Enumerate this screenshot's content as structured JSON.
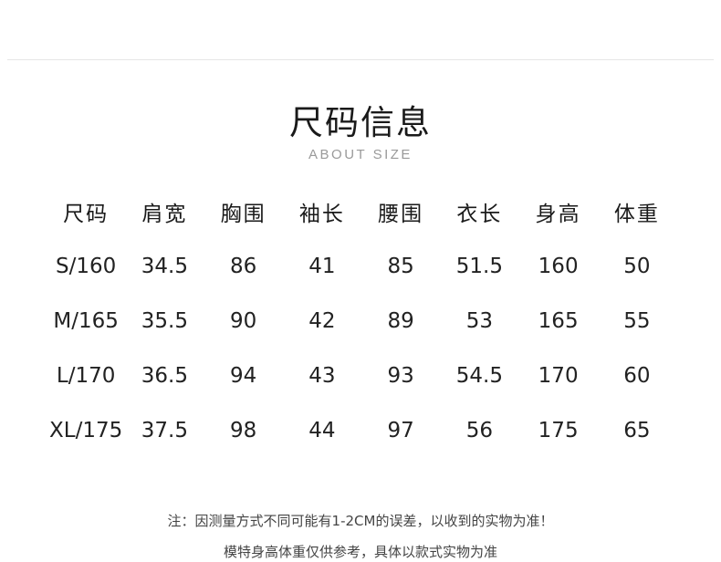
{
  "heading": {
    "title": "尺码信息",
    "subtitle": "ABOUT SIZE"
  },
  "table": {
    "headers": [
      "尺码",
      "肩宽",
      "胸围",
      "袖长",
      "腰围",
      "衣长",
      "身高",
      "体重"
    ],
    "rows": [
      [
        "S/160",
        "34.5",
        "86",
        "41",
        "85",
        "51.5",
        "160",
        "50"
      ],
      [
        "M/165",
        "35.5",
        "90",
        "42",
        "89",
        "53",
        "165",
        "55"
      ],
      [
        "L/170",
        "36.5",
        "94",
        "43",
        "93",
        "54.5",
        "170",
        "60"
      ],
      [
        "XL/175",
        "37.5",
        "98",
        "44",
        "97",
        "56",
        "175",
        "65"
      ]
    ]
  },
  "notes": {
    "line1": "注：因测量方式不同可能有1-2CM的误差，以收到的实物为准！",
    "line2": "模特身高体重仅供参考，具体以款式实物为准"
  },
  "colors": {
    "text": "#222222",
    "subtitle": "#9a9a9a",
    "divider": "#e6e6e6",
    "background": "#ffffff"
  }
}
